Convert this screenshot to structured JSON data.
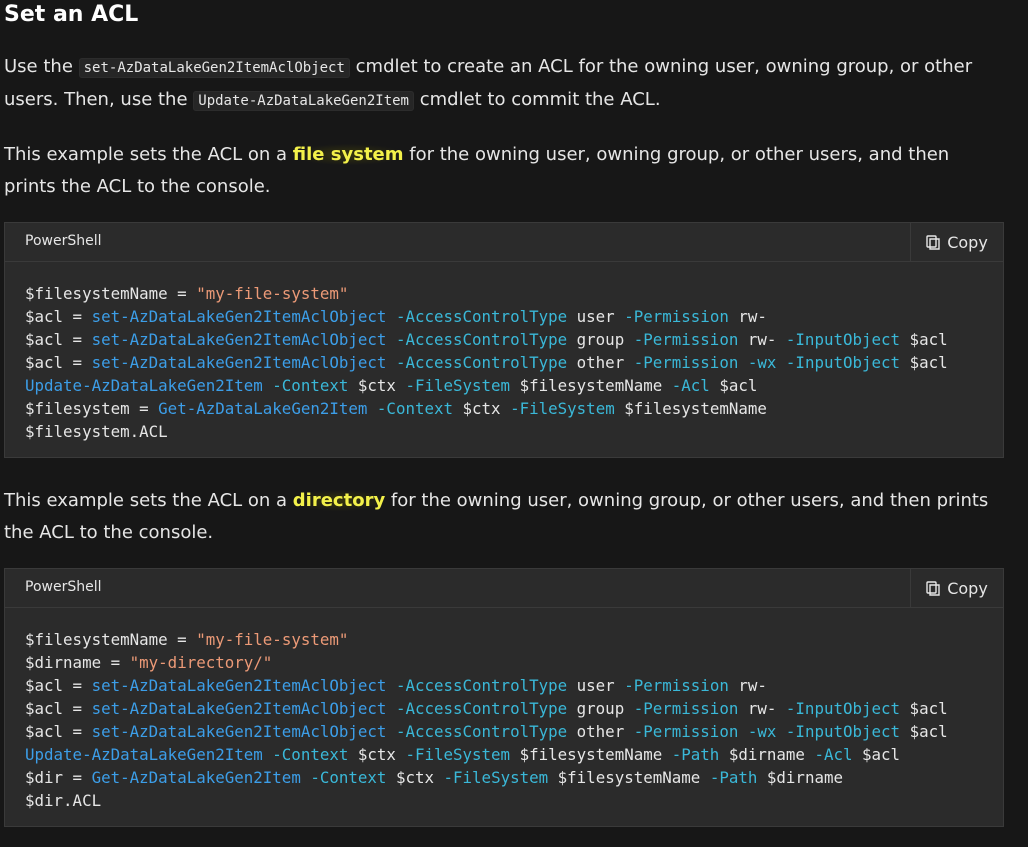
{
  "heading": "Set an ACL",
  "para1": {
    "t1": "Use the ",
    "code1": "set-AzDataLakeGen2ItemAclObject",
    "t2": " cmdlet to create an ACL for the owning user, owning group, or other users. Then, use the ",
    "code2": "Update-AzDataLakeGen2Item",
    "t3": " cmdlet to commit the ACL."
  },
  "para2": {
    "t1": "This example sets the ACL on a ",
    "hl": "file system",
    "t2": " for the owning user, owning group, or other users, and then prints the ACL to the console."
  },
  "para3": {
    "t1": "This example sets the ACL on a ",
    "hl": "directory",
    "t2": " for the owning user, owning group, or other users, and then prints the ACL to the console."
  },
  "code_block_1": {
    "language": "PowerShell",
    "copy_label": "Copy",
    "lines": [
      [
        [
          "var",
          "$filesystemName"
        ],
        [
          "op",
          " = "
        ],
        [
          "str",
          "\"my-file-system\""
        ]
      ],
      [
        [
          "var",
          "$acl"
        ],
        [
          "op",
          " = "
        ],
        [
          "cmd",
          "set-AzDataLakeGen2ItemAclObject"
        ],
        [
          "plain",
          " "
        ],
        [
          "param",
          "-AccessControlType"
        ],
        [
          "plain",
          " user "
        ],
        [
          "param",
          "-Permission"
        ],
        [
          "plain",
          " rw-"
        ]
      ],
      [
        [
          "var",
          "$acl"
        ],
        [
          "op",
          " = "
        ],
        [
          "cmd",
          "set-AzDataLakeGen2ItemAclObject"
        ],
        [
          "plain",
          " "
        ],
        [
          "param",
          "-AccessControlType"
        ],
        [
          "plain",
          " group "
        ],
        [
          "param",
          "-Permission"
        ],
        [
          "plain",
          " rw- "
        ],
        [
          "param",
          "-InputObject"
        ],
        [
          "plain",
          " $acl"
        ]
      ],
      [
        [
          "var",
          "$acl"
        ],
        [
          "op",
          " = "
        ],
        [
          "cmd",
          "set-AzDataLakeGen2ItemAclObject"
        ],
        [
          "plain",
          " "
        ],
        [
          "param",
          "-AccessControlType"
        ],
        [
          "plain",
          " other "
        ],
        [
          "param",
          "-Permission"
        ],
        [
          "plain",
          " "
        ],
        [
          "param",
          "-wx"
        ],
        [
          "plain",
          " "
        ],
        [
          "param",
          "-InputObject"
        ],
        [
          "plain",
          " $acl"
        ]
      ],
      [
        [
          "cmd",
          "Update-AzDataLakeGen2Item"
        ],
        [
          "plain",
          " "
        ],
        [
          "param",
          "-Context"
        ],
        [
          "plain",
          " $ctx "
        ],
        [
          "param",
          "-FileSystem"
        ],
        [
          "plain",
          " $filesystemName "
        ],
        [
          "param",
          "-Acl"
        ],
        [
          "plain",
          " $acl"
        ]
      ],
      [
        [
          "var",
          "$filesystem"
        ],
        [
          "op",
          " = "
        ],
        [
          "cmd",
          "Get-AzDataLakeGen2Item"
        ],
        [
          "plain",
          " "
        ],
        [
          "param",
          "-Context"
        ],
        [
          "plain",
          " $ctx "
        ],
        [
          "param",
          "-FileSystem"
        ],
        [
          "plain",
          " $filesystemName"
        ]
      ],
      [
        [
          "var",
          "$filesystem.ACL"
        ]
      ]
    ]
  },
  "code_block_2": {
    "language": "PowerShell",
    "copy_label": "Copy",
    "lines": [
      [
        [
          "var",
          "$filesystemName"
        ],
        [
          "op",
          " = "
        ],
        [
          "str",
          "\"my-file-system\""
        ]
      ],
      [
        [
          "var",
          "$dirname"
        ],
        [
          "op",
          " = "
        ],
        [
          "str",
          "\"my-directory/\""
        ]
      ],
      [
        [
          "var",
          "$acl"
        ],
        [
          "op",
          " = "
        ],
        [
          "cmd",
          "set-AzDataLakeGen2ItemAclObject"
        ],
        [
          "plain",
          " "
        ],
        [
          "param",
          "-AccessControlType"
        ],
        [
          "plain",
          " user "
        ],
        [
          "param",
          "-Permission"
        ],
        [
          "plain",
          " rw-"
        ]
      ],
      [
        [
          "var",
          "$acl"
        ],
        [
          "op",
          " = "
        ],
        [
          "cmd",
          "set-AzDataLakeGen2ItemAclObject"
        ],
        [
          "plain",
          " "
        ],
        [
          "param",
          "-AccessControlType"
        ],
        [
          "plain",
          " group "
        ],
        [
          "param",
          "-Permission"
        ],
        [
          "plain",
          " rw- "
        ],
        [
          "param",
          "-InputObject"
        ],
        [
          "plain",
          " $acl"
        ]
      ],
      [
        [
          "var",
          "$acl"
        ],
        [
          "op",
          " = "
        ],
        [
          "cmd",
          "set-AzDataLakeGen2ItemAclObject"
        ],
        [
          "plain",
          " "
        ],
        [
          "param",
          "-AccessControlType"
        ],
        [
          "plain",
          " other "
        ],
        [
          "param",
          "-Permission"
        ],
        [
          "plain",
          " "
        ],
        [
          "param",
          "-wx"
        ],
        [
          "plain",
          " "
        ],
        [
          "param",
          "-InputObject"
        ],
        [
          "plain",
          " $acl"
        ]
      ],
      [
        [
          "cmd",
          "Update-AzDataLakeGen2Item"
        ],
        [
          "plain",
          " "
        ],
        [
          "param",
          "-Context"
        ],
        [
          "plain",
          " $ctx "
        ],
        [
          "param",
          "-FileSystem"
        ],
        [
          "plain",
          " $filesystemName "
        ],
        [
          "param",
          "-Path"
        ],
        [
          "plain",
          " $dirname "
        ],
        [
          "param",
          "-Acl"
        ],
        [
          "plain",
          " $acl"
        ]
      ],
      [
        [
          "var",
          "$dir"
        ],
        [
          "op",
          " = "
        ],
        [
          "cmd",
          "Get-AzDataLakeGen2Item"
        ],
        [
          "plain",
          " "
        ],
        [
          "param",
          "-Context"
        ],
        [
          "plain",
          " $ctx "
        ],
        [
          "param",
          "-FileSystem"
        ],
        [
          "plain",
          " $filesystemName "
        ],
        [
          "param",
          "-Path"
        ],
        [
          "plain",
          " $dirname"
        ]
      ],
      [
        [
          "var",
          "$dir.ACL"
        ]
      ]
    ]
  },
  "colors": {
    "background": "#171717",
    "code_background": "#2b2b2b",
    "highlight": "#f3f14a",
    "string": "#ec9a77",
    "cmdlet": "#3c9ee8",
    "parameter": "#3ab8d8"
  },
  "icons": {
    "copy": "copy-icon"
  }
}
